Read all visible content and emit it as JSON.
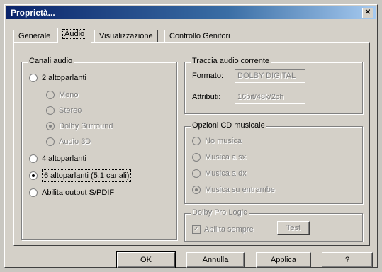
{
  "window": {
    "title": "Proprietà..."
  },
  "tabs": [
    "Generale",
    "Audio",
    "Visualizzazione",
    "Controllo Genitori"
  ],
  "channels": {
    "title": "Canali audio",
    "options": [
      {
        "label": "2 altoparlanti",
        "checked": false
      },
      {
        "label": "4 altoparlanti",
        "checked": false
      },
      {
        "label": "6 altoparlanti (5.1 canali)",
        "checked": true
      },
      {
        "label": "Abilita output S/PDIF",
        "checked": false
      }
    ],
    "sub_options": [
      {
        "label": "Mono",
        "checked": false
      },
      {
        "label": "Stereo",
        "checked": false
      },
      {
        "label": "Dolby Surround",
        "checked": true
      },
      {
        "label": "Audio 3D",
        "checked": false
      }
    ]
  },
  "current_track": {
    "title": "Traccia audio corrente",
    "format_label": "Formato:",
    "format_value": "DOLBY DIGITAL",
    "attributes_label": "Attributi:",
    "attributes_value": "16bit/48k/2ch"
  },
  "cd_options": {
    "title": "Opzioni CD musicale",
    "options": [
      {
        "label": "No musica",
        "checked": false
      },
      {
        "label": "Musica a sx",
        "checked": false
      },
      {
        "label": "Musica a dx",
        "checked": false
      },
      {
        "label": "Musica su entrambe",
        "checked": true
      }
    ]
  },
  "dolby": {
    "title": "Dolby Pro Logic",
    "checkbox_label": "Abilita sempre",
    "test_label": "Test"
  },
  "buttons": {
    "ok": "OK",
    "cancel": "Annulla",
    "apply": "Applica",
    "help": "?"
  }
}
